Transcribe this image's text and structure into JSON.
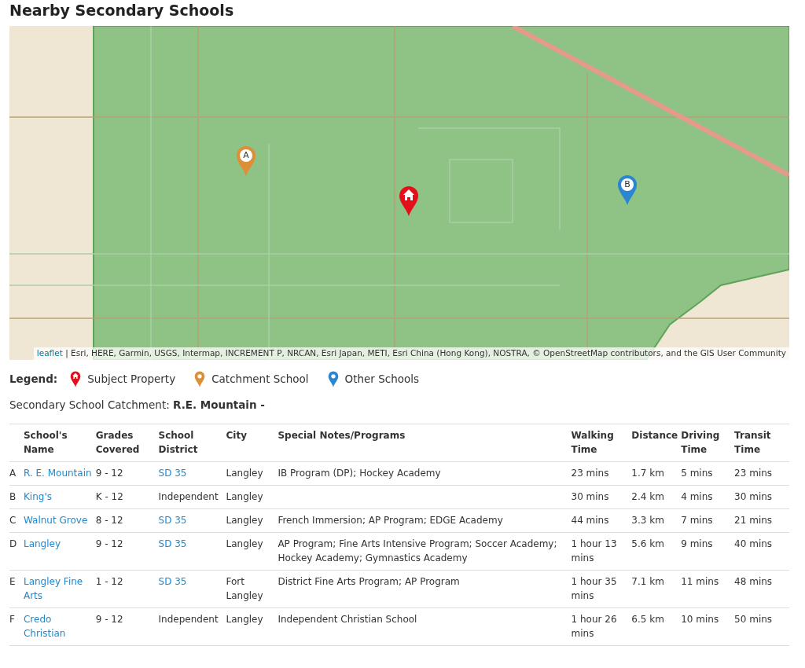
{
  "title": "Nearby Secondary Schools",
  "map": {
    "markers": [
      {
        "kind": "catchment",
        "letter": "A"
      },
      {
        "kind": "subject"
      },
      {
        "kind": "other",
        "letter": "B"
      }
    ],
    "attribution": {
      "link": "leaflet",
      "text": "| Esri, HERE, Garmin, USGS, Intermap, INCREMENT P, NRCAN, Esri Japan, METI, Esri China (Hong Kong), NOSTRA, © OpenStreetMap contributors, and the GIS User Community"
    }
  },
  "legend": {
    "label": "Legend:",
    "items": [
      {
        "kind": "subject",
        "label": "Subject Property"
      },
      {
        "kind": "catchment",
        "label": "Catchment School"
      },
      {
        "kind": "other",
        "label": "Other Schools"
      }
    ]
  },
  "catchment": {
    "label": "Secondary School Catchment:",
    "value": "R.E. Mountain -"
  },
  "table": {
    "columns": [
      "School's Name",
      "Grades Covered",
      "School District",
      "City",
      "Special Notes/Programs",
      "Walking Time",
      "Distance",
      "Driving Time",
      "Transit Time"
    ],
    "rows": [
      {
        "letter": "A",
        "name": "R. E. Mountain",
        "grades": "9 - 12",
        "district": "SD 35",
        "district_link": true,
        "city": "Langley",
        "notes": "IB Program (DP); Hockey Academy",
        "walking": "23 mins",
        "distance": "1.7 km",
        "driving": "5 mins",
        "transit": "23 mins"
      },
      {
        "letter": "B",
        "name": "King's",
        "grades": "K - 12",
        "district": "Independent",
        "district_link": false,
        "city": "Langley",
        "notes": "",
        "walking": "30 mins",
        "distance": "2.4 km",
        "driving": "4 mins",
        "transit": "30 mins"
      },
      {
        "letter": "C",
        "name": "Walnut Grove",
        "grades": "8 - 12",
        "district": "SD 35",
        "district_link": true,
        "city": "Langley",
        "notes": "French Immersion; AP Program; EDGE Academy",
        "walking": "44 mins",
        "distance": "3.3 km",
        "driving": "7 mins",
        "transit": "21 mins"
      },
      {
        "letter": "D",
        "name": "Langley",
        "grades": "9 - 12",
        "district": "SD 35",
        "district_link": true,
        "city": "Langley",
        "notes": "AP Program; Fine Arts Intensive Program; Soccer Academy; Hockey Academy; Gymnastics Academy",
        "walking": "1 hour 13 mins",
        "distance": "5.6 km",
        "driving": "9 mins",
        "transit": "40 mins"
      },
      {
        "letter": "E",
        "name": "Langley Fine Arts",
        "grades": "1 - 12",
        "district": "SD 35",
        "district_link": true,
        "city": "Fort Langley",
        "notes": "District Fine Arts Program; AP Program",
        "walking": "1 hour 35 mins",
        "distance": "7.1 km",
        "driving": "11 mins",
        "transit": "48 mins"
      },
      {
        "letter": "F",
        "name": "Credo Christian",
        "grades": "9 - 12",
        "district": "Independent",
        "district_link": false,
        "city": "Langley",
        "notes": "Independent Christian School",
        "walking": "1 hour 26 mins",
        "distance": "6.5 km",
        "driving": "10 mins",
        "transit": "50 mins"
      }
    ]
  }
}
